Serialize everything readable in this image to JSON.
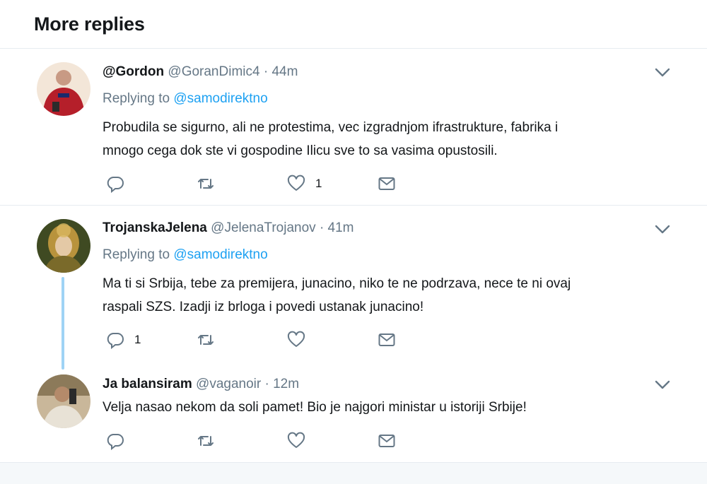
{
  "header": {
    "title": "More replies"
  },
  "tweets": [
    {
      "name": "@Gordon",
      "handle": "@GoranDimic4",
      "dot": "·",
      "time": "44m",
      "replying_prefix": "Replying to",
      "replying_to": "@samodirektno",
      "text_lines": [
        "Probudila se sigurno, ali ne protestima, vec izgradnjom ifrastrukture, fabrika i",
        "mnogo cega dok ste vi gospodine Ilicu sve to sa vasima opustosili."
      ],
      "reply_count": "",
      "retweet_count": "",
      "like_count": "1"
    },
    {
      "name": "TrojanskaJelena",
      "handle": "@JelenaTrojanov",
      "dot": "·",
      "time": "41m",
      "replying_prefix": "Replying to",
      "replying_to": "@samodirektno",
      "text_lines": [
        "Ma ti si Srbija, tebe za premijera, junacino, niko te ne podrzava, nece te ni ovaj",
        "raspali SZS. Izadji iz brloga i povedi ustanak junacino!"
      ],
      "reply_count": "1",
      "retweet_count": "",
      "like_count": ""
    },
    {
      "name": "Ja balansiram",
      "handle": "@vaganoir",
      "dot": "·",
      "time": "12m",
      "text_lines": [
        "Velja nasao nekom da soli pamet! Bio je najgori ministar u istoriji Srbije!"
      ],
      "reply_count": "",
      "retweet_count": "",
      "like_count": ""
    }
  ],
  "icons": {
    "reply": "reply-icon",
    "retweet": "retweet-icon",
    "like": "heart-icon",
    "message": "envelope-icon",
    "more": "chevron-down-icon"
  },
  "colors": {
    "link": "#1da1f2",
    "muted": "#657786",
    "thread": "#9fd3f5"
  }
}
